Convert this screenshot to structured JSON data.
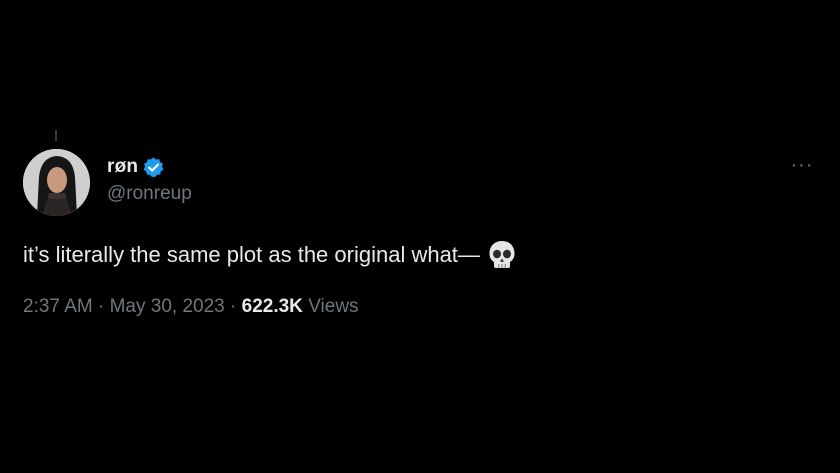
{
  "tweet": {
    "author": {
      "display_name": "røn",
      "handle": "@ronreup",
      "verified": true
    },
    "more_icon": "more-horizontal-icon",
    "text": "it’s literally the same plot as the original what—",
    "emoji": "skull-emoji",
    "meta": {
      "time": "2:37 AM",
      "separator1": " · ",
      "date": "May 30, 2023",
      "separator2": " · ",
      "views_count": "622.3K",
      "views_label": " Views"
    }
  },
  "colors": {
    "background": "#000000",
    "primary_text": "#e7e9ea",
    "secondary_text": "#71767b",
    "verified_badge": "#1d9bf0"
  }
}
